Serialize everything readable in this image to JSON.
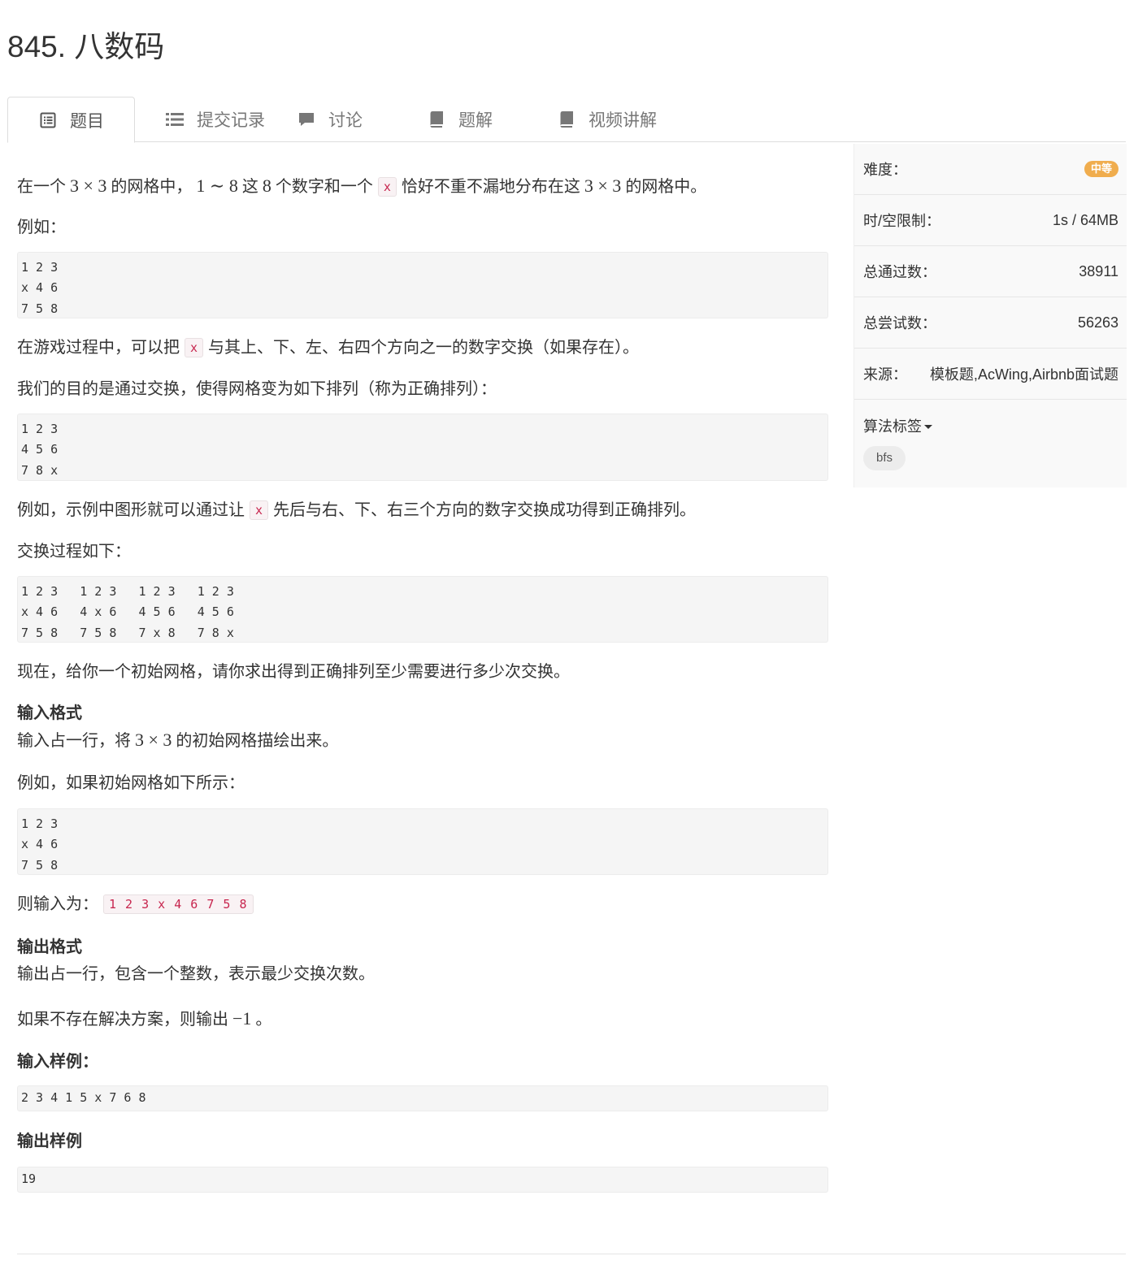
{
  "page": {
    "title": "845. 八数码"
  },
  "tabs": [
    {
      "label": "题目",
      "icon": "list-alt-icon"
    },
    {
      "label": "提交记录",
      "icon": "list-icon"
    },
    {
      "label": "讨论",
      "icon": "comment-icon"
    },
    {
      "label": "题解",
      "icon": "book-icon"
    },
    {
      "label": "视频讲解",
      "icon": "book-icon"
    }
  ],
  "problem": {
    "intro": {
      "a": "在一个",
      "m1": "3 × 3",
      "b": "的网格中，",
      "m2": "1 ∼ 8",
      "c": "这",
      "m3": "8",
      "d": "个数字和一个",
      "x": "x",
      "e": "恰好不重不漏地分布在这",
      "m4": "3 × 3",
      "f": "的网格中。"
    },
    "example_label": "例如：",
    "grid1": "1 2 3\nx 4 6\n7 5 8",
    "swap_rule": {
      "a": "在游戏过程中，可以把",
      "x": "x",
      "b": "与其上、下、左、右四个方向之一的数字交换（如果存在）。"
    },
    "goal": "我们的目的是通过交换，使得网格变为如下排列（称为正确排列）：",
    "grid2": "1 2 3\n4 5 6\n7 8 x",
    "example_desc": {
      "a": "例如，示例中图形就可以通过让",
      "x": "x",
      "b": "先后与右、下、右三个方向的数字交换成功得到正确排列。"
    },
    "process_label": "交换过程如下：",
    "grid3": "1 2 3   1 2 3   1 2 3   1 2 3\nx 4 6   4 x 6   4 5 6   4 5 6\n7 5 8   7 5 8   7 x 8   7 8 x",
    "task": "现在，给你一个初始网格，请你求出得到正确排列至少需要进行多少次交换。",
    "input_format_title": "输入格式",
    "input_format": {
      "a": "输入占一行，将",
      "m": "3 × 3",
      "b": "的初始网格描绘出来。"
    },
    "input_example_label": "例如，如果初始网格如下所示：",
    "grid4": "1 2 3\nx 4 6\n7 5 8",
    "input_is": {
      "a": "则输入为：",
      "code": "1 2 3 x 4 6 7 5 8"
    },
    "output_format_title": "输出格式",
    "output_format": "输出占一行，包含一个整数，表示最少交换次数。",
    "no_solution": {
      "a": "如果不存在解决方案，则输出",
      "m": "−1",
      "b": "。"
    },
    "sample_input_title": "输入样例：",
    "sample_input": "2 3 4 1 5 x 7 6 8",
    "sample_output_title": "输出样例",
    "sample_output": "19"
  },
  "sidebar": {
    "difficulty_label": "难度：",
    "difficulty": "中等",
    "limits_label": "时/空限制：",
    "limits": "1s / 64MB",
    "passed_label": "总通过数：",
    "passed": "38911",
    "tried_label": "总尝试数：",
    "tried": "56263",
    "source_label": "来源：",
    "source": "模板题,AcWing,Airbnb面试题",
    "tags_label": "算法标签",
    "tags": [
      "bfs"
    ]
  },
  "colors": {
    "badge": "#f0ad4e",
    "inline_code": "#c7254e",
    "code_bg": "#f5f5f5"
  }
}
